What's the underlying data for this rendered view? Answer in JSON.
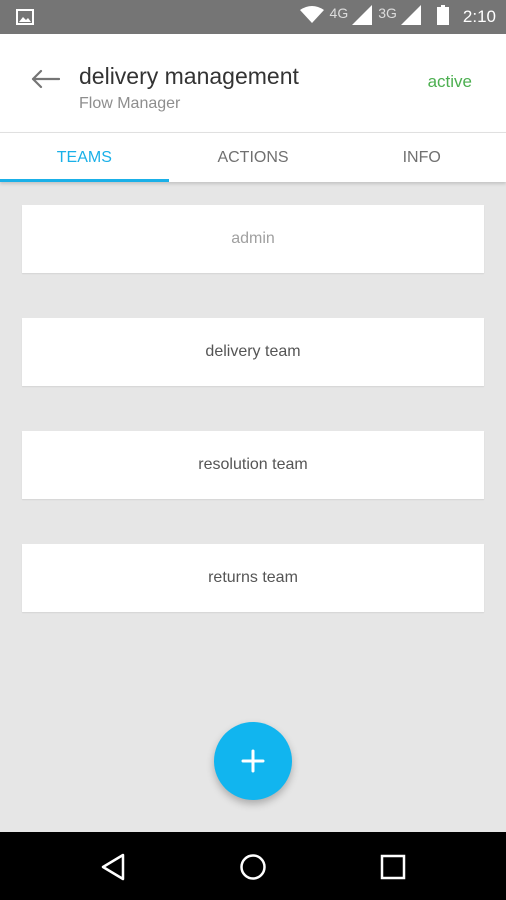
{
  "status_bar": {
    "time": "2:10",
    "network_1": "4G",
    "network_2": "3G",
    "icons": [
      "gallery-icon",
      "wifi-icon",
      "signal-icon",
      "battery-icon"
    ]
  },
  "header": {
    "title": "delivery management",
    "subtitle": "Flow Manager",
    "status": "active",
    "status_color": "#4caf50"
  },
  "tabs": [
    {
      "label": "TEAMS",
      "active": true
    },
    {
      "label": "ACTIONS",
      "active": false
    },
    {
      "label": "INFO",
      "active": false
    }
  ],
  "teams": [
    {
      "name": "admin"
    },
    {
      "name": "delivery team"
    },
    {
      "name": "resolution team"
    },
    {
      "name": "returns team"
    }
  ],
  "fab": {
    "icon": "plus-icon"
  },
  "colors": {
    "accent": "#1ab0e8",
    "fab": "#11b5ef",
    "background": "#e6e6e6"
  },
  "nav_bar": {
    "icons": [
      "back-triangle-icon",
      "home-circle-icon",
      "recents-square-icon"
    ]
  }
}
